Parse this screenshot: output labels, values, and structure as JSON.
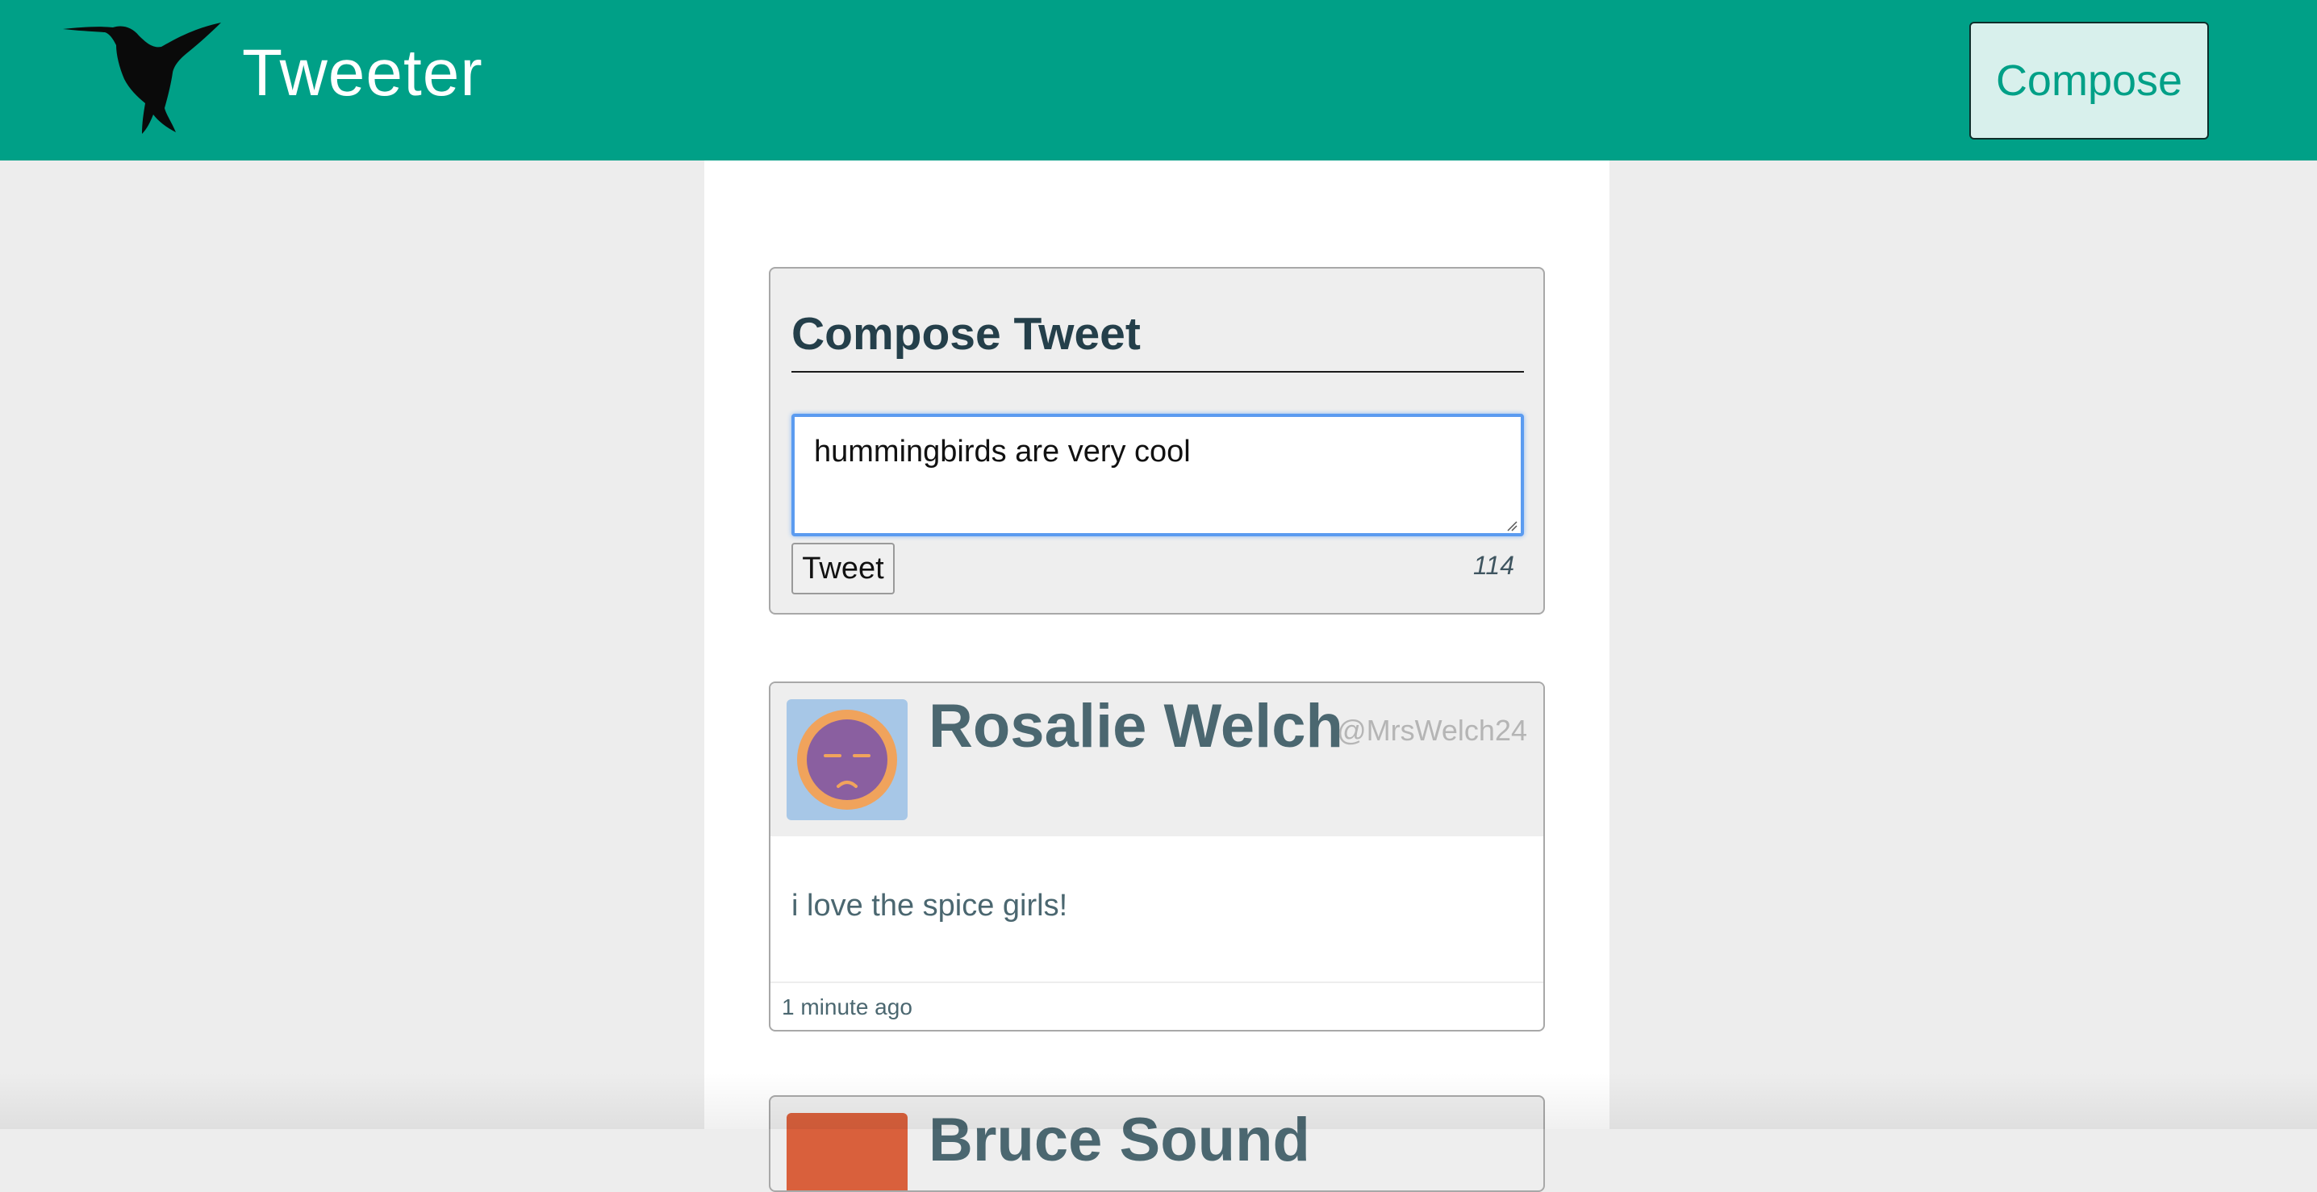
{
  "header": {
    "brand": "Tweeter",
    "compose_label": "Compose",
    "logo_icon": "hummingbird-icon",
    "bar_color": "#00a087"
  },
  "compose": {
    "title": "Compose Tweet",
    "input_value": "hummingbirds are very cool",
    "tweet_button_label": "Tweet",
    "char_counter": "114"
  },
  "tweets": [
    {
      "name": "Rosalie Welch",
      "handle": "@MrsWelch24",
      "text": "i love the spice girls!",
      "time": "1 minute ago"
    },
    {
      "name": "Bruce Sound"
    }
  ]
}
